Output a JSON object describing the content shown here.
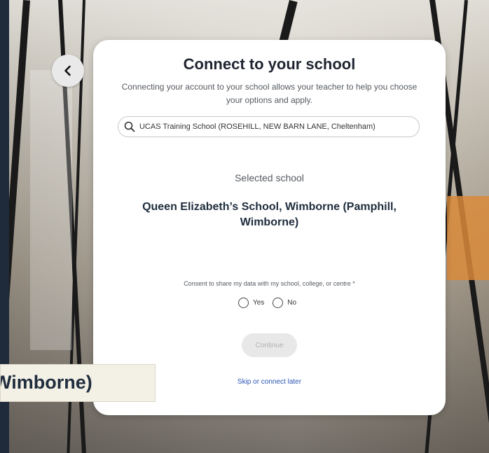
{
  "card": {
    "title": "Connect to your school",
    "subtitle": "Connecting your account to your school allows your teacher to help you choose your options and apply.",
    "search_value": "UCAS Training School (ROSEHILL, NEW BARN LANE, Cheltenham)",
    "selected_label": "Selected school",
    "selected_school": "Queen Elizabeth’s School, Wimborne (Pamphill, Wimborne)",
    "consent_label": "Consent to share my data with my school, college, or centre *",
    "yes_label": "Yes",
    "no_label": "No",
    "continue_label": "Continue",
    "skip_label": "Skip or connect later"
  },
  "zoom_callout": {
    "text": "Wimborne)"
  },
  "icons": {
    "back": "chevron-left-icon",
    "search": "search-icon"
  }
}
